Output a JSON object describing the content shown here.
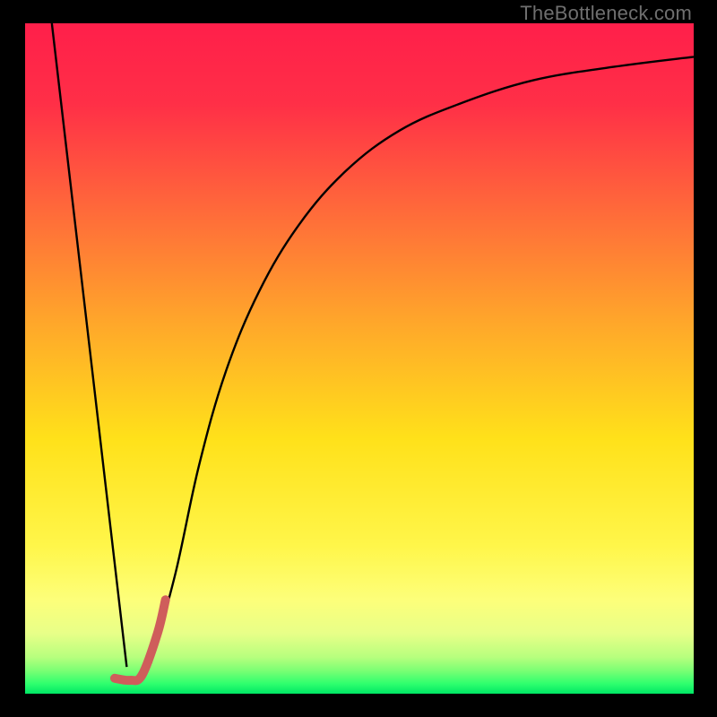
{
  "watermark": "TheBottleneck.com",
  "gradient": {
    "stops": [
      {
        "offset": 0.0,
        "color": "#ff1f4a"
      },
      {
        "offset": 0.12,
        "color": "#ff2f47"
      },
      {
        "offset": 0.28,
        "color": "#ff6a3a"
      },
      {
        "offset": 0.45,
        "color": "#ffa82a"
      },
      {
        "offset": 0.62,
        "color": "#ffe11a"
      },
      {
        "offset": 0.78,
        "color": "#fff64a"
      },
      {
        "offset": 0.86,
        "color": "#fdff7a"
      },
      {
        "offset": 0.91,
        "color": "#e8ff88"
      },
      {
        "offset": 0.945,
        "color": "#b8ff7e"
      },
      {
        "offset": 0.965,
        "color": "#7dff74"
      },
      {
        "offset": 0.985,
        "color": "#2fff6e"
      },
      {
        "offset": 1.0,
        "color": "#00e765"
      }
    ]
  },
  "chart_data": {
    "type": "line",
    "title": "",
    "xlabel": "",
    "ylabel": "",
    "xlim": [
      0,
      100
    ],
    "ylim": [
      0,
      100
    ],
    "series": [
      {
        "name": "curve-left",
        "stroke": "#000000",
        "stroke_width": 2.4,
        "points": [
          {
            "x": 4.0,
            "y": 100.0
          },
          {
            "x": 15.2,
            "y": 4.0
          }
        ]
      },
      {
        "name": "curve-right",
        "stroke": "#000000",
        "stroke_width": 2.4,
        "points": [
          {
            "x": 18.8,
            "y": 4.5
          },
          {
            "x": 22.5,
            "y": 18.0
          },
          {
            "x": 26.0,
            "y": 34.0
          },
          {
            "x": 30.0,
            "y": 48.0
          },
          {
            "x": 35.0,
            "y": 60.0
          },
          {
            "x": 41.0,
            "y": 70.0
          },
          {
            "x": 48.0,
            "y": 78.0
          },
          {
            "x": 56.0,
            "y": 84.0
          },
          {
            "x": 65.0,
            "y": 88.0
          },
          {
            "x": 76.0,
            "y": 91.5
          },
          {
            "x": 88.0,
            "y": 93.5
          },
          {
            "x": 100.0,
            "y": 95.0
          }
        ]
      },
      {
        "name": "tick-highlight",
        "stroke": "#cf5d5b",
        "stroke_width": 10,
        "linecap": "round",
        "points": [
          {
            "x": 13.4,
            "y": 2.3
          },
          {
            "x": 15.7,
            "y": 2.0
          },
          {
            "x": 17.5,
            "y": 2.8
          },
          {
            "x": 19.8,
            "y": 9.0
          },
          {
            "x": 21.0,
            "y": 14.0
          }
        ]
      }
    ]
  }
}
